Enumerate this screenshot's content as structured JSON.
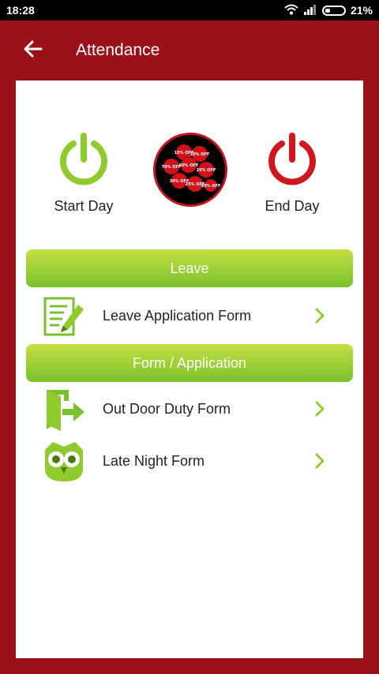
{
  "status_bar": {
    "time": "18:28",
    "battery": "21%",
    "icons": [
      "wifi-icon",
      "signal-icon",
      "battery-icon"
    ]
  },
  "app_bar": {
    "title": "Attendance",
    "back_icon": "arrow-left-icon"
  },
  "attendance": {
    "start_label": "Start Day",
    "end_label": "End Day",
    "promo_icon": "discount-balloons-icon",
    "promo_tags": [
      "15% OFF",
      "10% OFF",
      "70% OFF",
      "50% OFF",
      "20% OFF",
      "30% OFF",
      "25% OFF",
      "60% OFF"
    ]
  },
  "sections": {
    "leave": "Leave",
    "forms": "Form / Application"
  },
  "items": {
    "leave_application": "Leave Application Form",
    "out_door": "Out Door Duty Form",
    "late_night": "Late Night Form"
  },
  "colors": {
    "brand_red": "#9c1118",
    "start_green": "#8fcb2c",
    "end_red": "#d0171d",
    "gradient_top": "#c3df42",
    "gradient_bottom": "#7cc12d"
  }
}
